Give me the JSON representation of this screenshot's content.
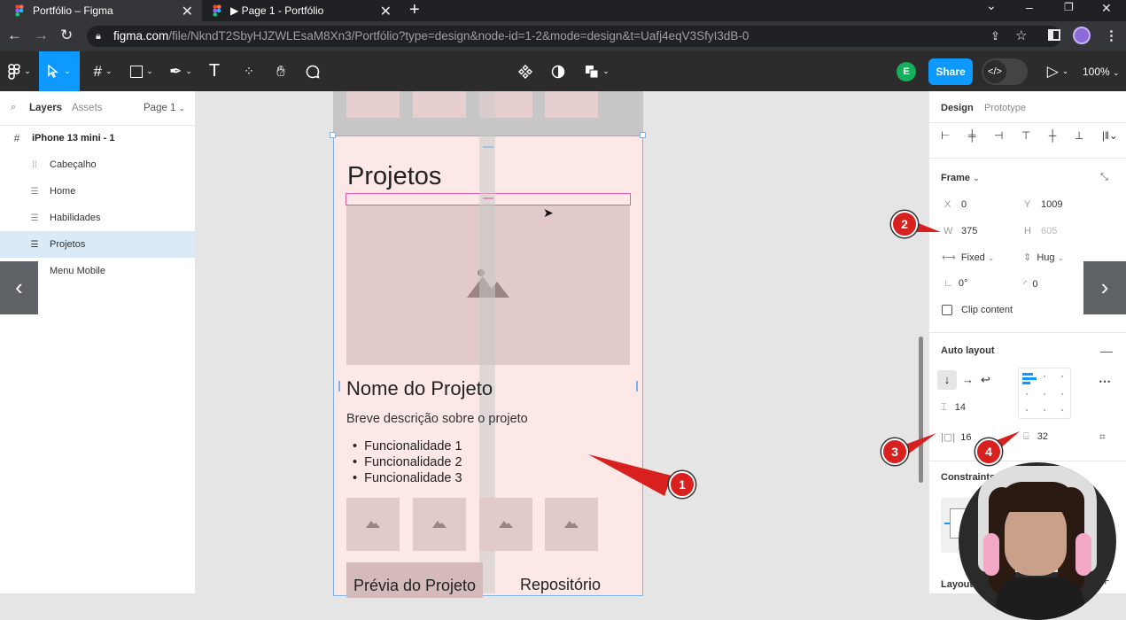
{
  "browser": {
    "tabs": [
      {
        "title": "Portfólio – Figma",
        "active": true
      },
      {
        "title": "▶ Page 1 - Portfólio",
        "active": false
      }
    ],
    "url_host": "figma.com",
    "url_rest": "/file/NkndT2SbyHJZWLEsaM8Xn3/Portfólio?type=design&node-id=1-2&mode=design&t=Uafj4eqV3SfyI3dB-0"
  },
  "toolbar": {
    "avatar_initial": "E",
    "share_label": "Share",
    "dev_icon": "</>",
    "zoom": "100%"
  },
  "left_panel": {
    "tab_layers": "Layers",
    "tab_assets": "Assets",
    "page_selector": "Page 1",
    "frame_name": "iPhone 13 mini - 1",
    "layers": [
      "Cabeçalho",
      "Home",
      "Habilidades",
      "Projetos",
      "Menu Mobile"
    ],
    "selected_layer": "Projetos"
  },
  "canvas": {
    "section_title": "Projetos",
    "project_name": "Nome do Projeto",
    "project_desc": "Breve descrição sobre o projeto",
    "features": [
      "Funcionalidade 1",
      "Funcionalidade 2",
      "Funcionalidade 3"
    ],
    "btn_preview": "Prévia do Projeto",
    "btn_repo": "Repositório"
  },
  "right_panel": {
    "tab_design": "Design",
    "tab_prototype": "Prototype",
    "frame_label": "Frame",
    "x_label": "X",
    "x_value": "0",
    "y_label": "Y",
    "y_value": "1009",
    "w_label": "W",
    "w_value": "375",
    "h_label": "H",
    "h_value": "605",
    "width_mode": "Fixed",
    "height_mode": "Hug",
    "rotation": "0°",
    "radius": "0",
    "clip_content": "Clip content",
    "auto_layout_label": "Auto layout",
    "gap": "14",
    "padding_horizontal": "16",
    "padding_vertical": "32",
    "constraints_label": "Constraints",
    "layout_label": "Layout"
  },
  "callouts": [
    "1",
    "2",
    "3",
    "4"
  ],
  "colors": {
    "accent": "#0d99ff",
    "callout": "#d8201f",
    "selection": "#e25aa8",
    "frame_fill": "#fde8e8"
  }
}
